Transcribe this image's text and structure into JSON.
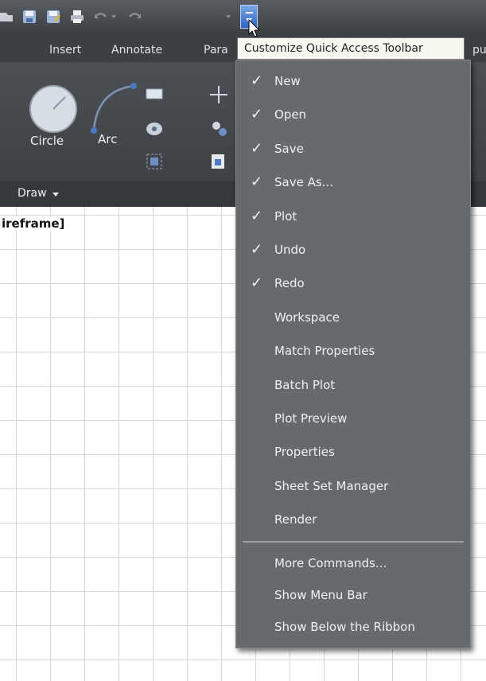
{
  "ribbon": {
    "tabs": [
      "Insert",
      "Annotate",
      "Para",
      "pu"
    ],
    "tools": {
      "circle": "Circle",
      "arc": "Arc"
    },
    "panel_title": "Draw"
  },
  "viewport": {
    "label": "ireframe]"
  },
  "tooltip": "Customize Quick Access Toolbar",
  "menu": {
    "items": [
      {
        "label": "New",
        "checked": true
      },
      {
        "label": "Open",
        "checked": true
      },
      {
        "label": "Save",
        "checked": true
      },
      {
        "label": "Save As...",
        "checked": true
      },
      {
        "label": "Plot",
        "checked": true
      },
      {
        "label": "Undo",
        "checked": true
      },
      {
        "label": "Redo",
        "checked": true
      },
      {
        "label": "Workspace",
        "checked": false
      },
      {
        "label": "Match Properties",
        "checked": false
      },
      {
        "label": "Batch Plot",
        "checked": false
      },
      {
        "label": "Plot Preview",
        "checked": false
      },
      {
        "label": "Properties",
        "checked": false
      },
      {
        "label": "Sheet Set Manager",
        "checked": false
      },
      {
        "label": "Render",
        "checked": false
      }
    ],
    "extra_items": [
      "More Commands...",
      "Show Menu Bar",
      "Show Below the Ribbon"
    ]
  },
  "check_glyph": "✓",
  "colors": {
    "accent": "#2d63c4",
    "menu_bg": "#666a6f"
  }
}
